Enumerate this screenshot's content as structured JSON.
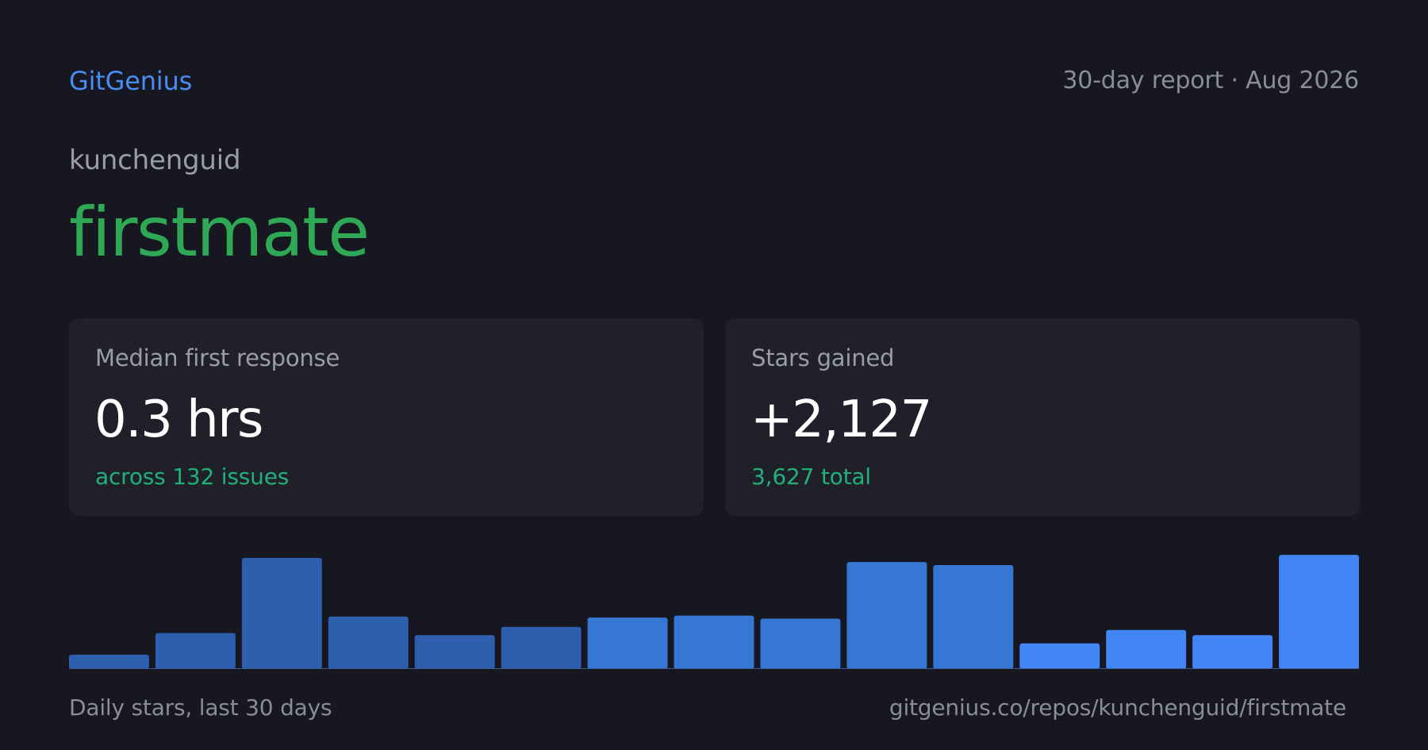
{
  "header": {
    "brand": "GitGenius",
    "report_label": "30-day report · Aug 2026"
  },
  "repo": {
    "owner": "kunchenguid",
    "name": "firstmate"
  },
  "stats": [
    {
      "label": "Median first response",
      "value": "0.3 hrs",
      "sub": "across 132 issues"
    },
    {
      "label": "Stars gained",
      "value": "+2,127",
      "sub": "3,627 total"
    }
  ],
  "footer": {
    "caption": "Daily stars, last 30 days",
    "url": "gitgenius.co/repos/kunchenguid/firstmate"
  },
  "colors": {
    "background": "#161720",
    "card": "#1f2029",
    "brand": "#4a8df0",
    "repo_name": "#2fa855",
    "accent_green": "#22b07a",
    "bar_early": "#2d5fae",
    "bar_mid": "#3777d4",
    "bar_late": "#4285f4"
  },
  "chart_data": {
    "type": "bar",
    "values": [
      14,
      35,
      108,
      51,
      33,
      41,
      50,
      52,
      49,
      104,
      101,
      25,
      38,
      33,
      111
    ],
    "ylim": [
      0,
      118
    ],
    "grid": false,
    "legend": "none"
  }
}
